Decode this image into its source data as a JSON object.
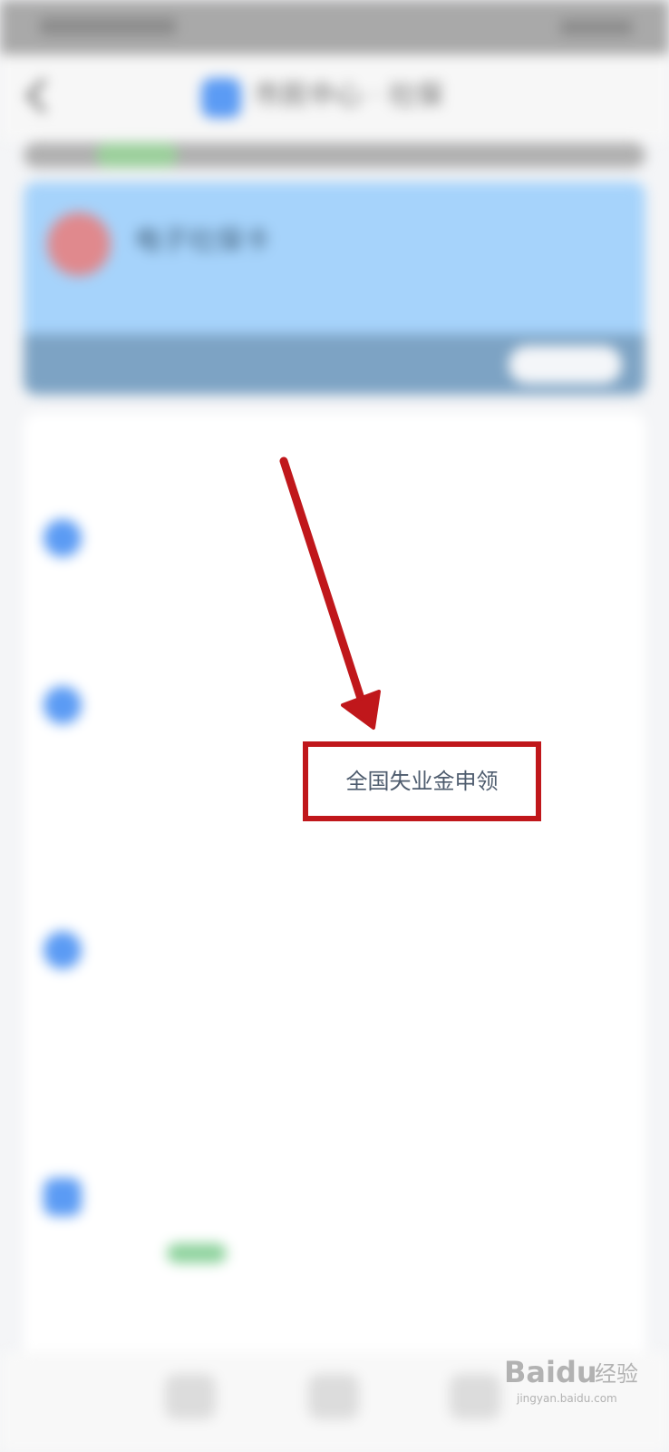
{
  "app": {
    "title": "市民中心 · 社保"
  },
  "status_bar": {
    "left": "",
    "right": ""
  },
  "card": {
    "title": "电子社保卡",
    "subtitle": "",
    "button_label": ""
  },
  "services_section": {
    "heading": "",
    "more_label": ""
  },
  "groups": [
    {
      "title": "",
      "items": [
        "",
        ""
      ]
    },
    {
      "title": "",
      "items": [
        "",
        "全国失业金申领",
        "",
        ""
      ]
    },
    {
      "title": "",
      "items": [
        "",
        "",
        ""
      ]
    },
    {
      "title": "",
      "items": [
        "",
        ""
      ]
    }
  ],
  "highlighted_item": {
    "label": "全国失业金申领"
  },
  "annotation": {
    "color": "#c0171b"
  },
  "watermark": {
    "brand": "Baidu",
    "cn": "经验",
    "url": "jingyan.baidu.com"
  },
  "colors": {
    "accent_blue": "#5b9bf4",
    "card_blue": "#a6d3fb",
    "annotation_red": "#c0171b"
  }
}
